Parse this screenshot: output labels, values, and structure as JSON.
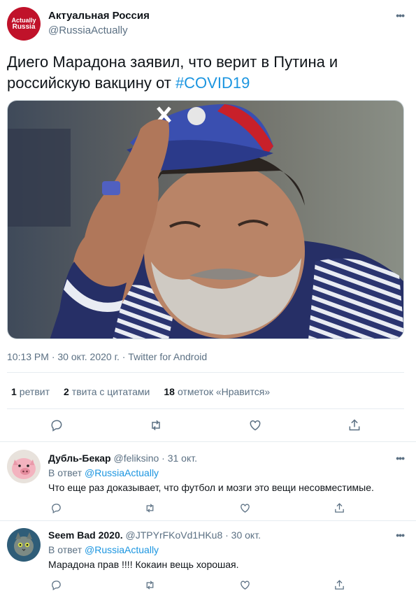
{
  "main": {
    "author_name": "Актуальная Россия",
    "author_handle": "@RussiaActually",
    "avatar_line1": "Actually",
    "avatar_line2": "Russia",
    "more": "•••",
    "text_plain": "Диего Марадона заявил, что верит в Путина и российскую вакцину от ",
    "hashtag": "#COVID19",
    "image_alt": "Фото Диего Марадоны",
    "timestamp": "10:13 PM · 30 окт. 2020 г. · Twitter for Android",
    "stats": {
      "retweets_count": "1",
      "retweets_label": "ретвит",
      "quotes_count": "2",
      "quotes_label": "твита с цитатами",
      "likes_count": "18",
      "likes_label": "отметок «Нравится»"
    }
  },
  "replies": [
    {
      "name": "Дубль-Бекар",
      "handle": "@feliksino",
      "time": "· 31 окт.",
      "in_reply_prefix": "В ответ",
      "in_reply_mention": "@RussiaActually",
      "text": "Что еще раз доказывает, что футбол и мозги это вещи несовместимые.",
      "more": "•••"
    },
    {
      "name": "Seem Bad 2020.",
      "handle": "@JTPYrFKoVd1HKu8",
      "time": "· 30 окт.",
      "in_reply_prefix": "В ответ",
      "in_reply_mention": "@RussiaActually",
      "text": "Марадона прав !!!! Кокаин вещь хорошая.",
      "more": "•••"
    }
  ],
  "icons": [
    "reply-icon",
    "retweet-icon",
    "like-icon",
    "share-icon",
    "more-icon"
  ],
  "colors": {
    "accent": "#1b95e0",
    "secondary_text": "#5b7083",
    "avatar_red": "#c0122a",
    "border": "#e6ecf0"
  }
}
